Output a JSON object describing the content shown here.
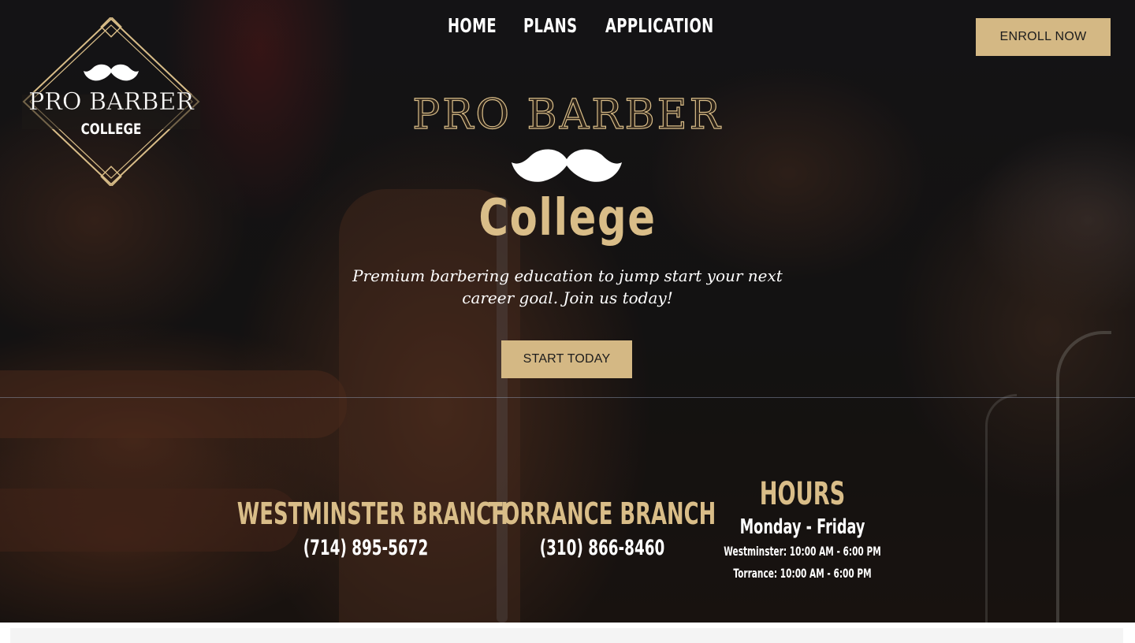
{
  "logo": {
    "line1": "PRO BARBER",
    "line2": "COLLEGE",
    "icon": "mustache-icon"
  },
  "nav": {
    "items": [
      "HOME",
      "PLANS",
      "APPLICATION"
    ]
  },
  "header": {
    "enroll_label": "ENROLL NOW"
  },
  "hero": {
    "title_line1": "PRO BARBER",
    "title_line2": "College",
    "tagline_line1": "Premium barbering education to jump start your next",
    "tagline_line2": "career goal. Join us today!",
    "cta_label": "START TODAY"
  },
  "branches": [
    {
      "name": "WESTMINSTER BRANCH",
      "phone": "(714) 895-5672"
    },
    {
      "name": "TORRANCE BRANCH",
      "phone": "(310) 866-8460"
    }
  ],
  "hours": {
    "title": "HOURS",
    "days": "Monday - Friday",
    "lines": [
      "Westminster: 10:00 AM - 6:00 PM",
      "Torrance: 10:00 AM - 6:00 PM"
    ]
  },
  "colors": {
    "accent": "#d4b884",
    "gold_text": "#d9bd88",
    "text_light": "#ffffff"
  }
}
